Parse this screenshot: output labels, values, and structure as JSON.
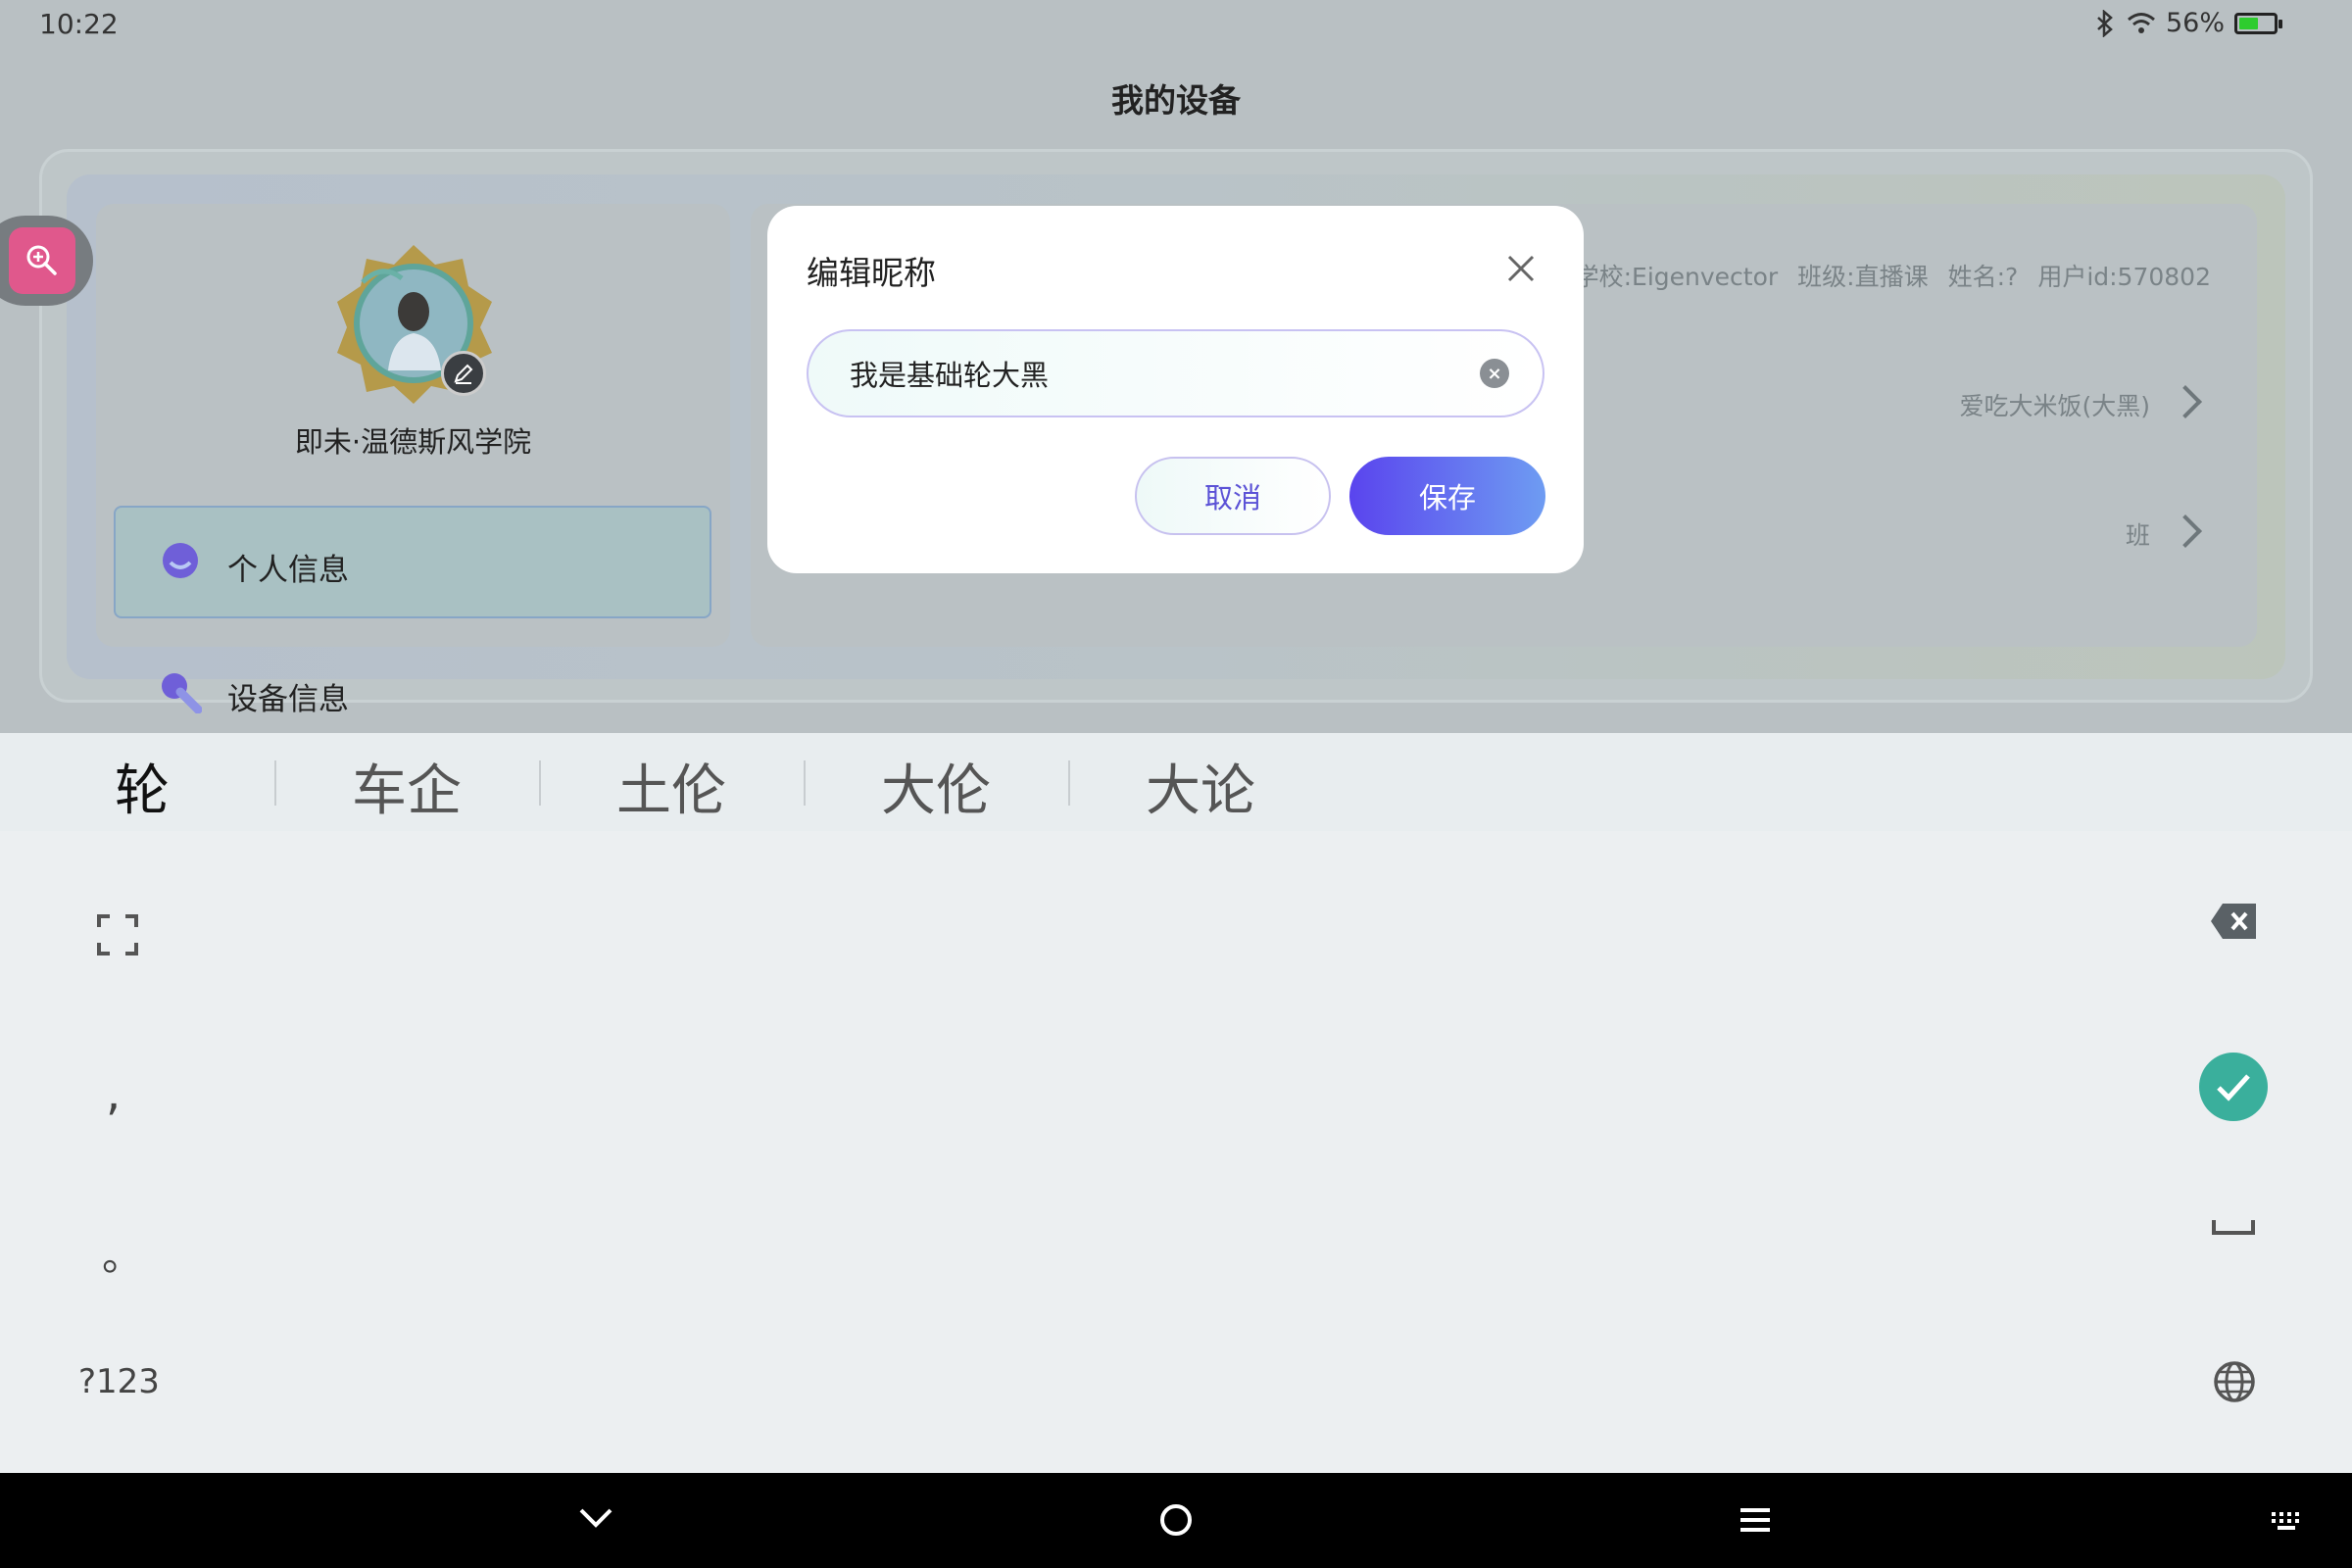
{
  "status_bar": {
    "time": "10:22",
    "battery": "56%",
    "battery_level": 0.56
  },
  "page": {
    "title": "我的设备"
  },
  "profile": {
    "school_name": "即未·温德斯风学院"
  },
  "menu": {
    "items": [
      {
        "label": "个人信息",
        "active": true
      },
      {
        "label": "设备信息",
        "active": false
      }
    ]
  },
  "info": {
    "school": "学校:Eigenvector",
    "class": "班级:直播课",
    "name": "姓名:?",
    "user_id": "用户id:570802"
  },
  "rows": [
    {
      "value": "爱吃大米饭(大黑)"
    },
    {
      "value": "班"
    }
  ],
  "dialog": {
    "title": "编辑昵称",
    "input_value": "我是基础轮大黑",
    "cancel_label": "取消",
    "save_label": "保存"
  },
  "candidates": [
    "轮",
    "车企",
    "土伦",
    "大伦",
    "大论"
  ],
  "keyboard": {
    "comma": ",",
    "period": "。",
    "symbols": "?123"
  },
  "colors": {
    "accent": "#5a44ee",
    "enter_key": "#3aaf9c",
    "zoom": "#e0588c"
  }
}
